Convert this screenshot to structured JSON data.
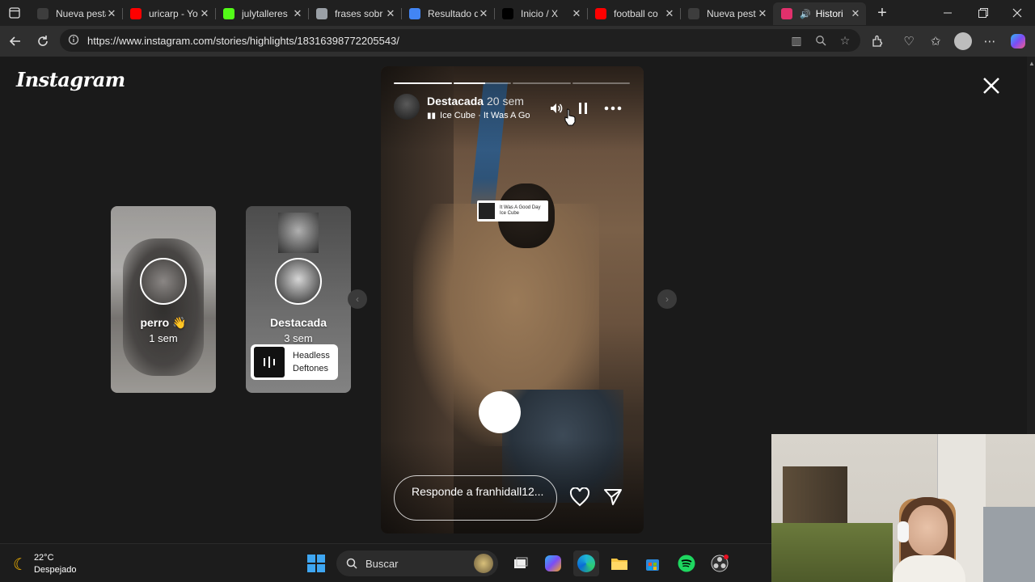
{
  "browser": {
    "tabs": [
      {
        "title": "Nueva pesta",
        "favicon_color": "#3d3d3d",
        "icon": "page-icon"
      },
      {
        "title": "uricarp - Yo",
        "favicon_color": "#ff0000",
        "icon": "youtube-icon"
      },
      {
        "title": "julytalleres",
        "favicon_color": "#53fc18",
        "icon": "kick-icon"
      },
      {
        "title": "frases sobr",
        "favicon_color": "#9aa0a6",
        "icon": "globe-icon"
      },
      {
        "title": "Resultado d",
        "favicon_color": "#4285f4",
        "icon": "google-icon"
      },
      {
        "title": "Inicio / X",
        "favicon_color": "#000000",
        "icon": "x-logo-icon"
      },
      {
        "title": "football co",
        "favicon_color": "#ff0000",
        "icon": "youtube-icon"
      },
      {
        "title": "Nueva pest",
        "favicon_color": "#3d3d3d",
        "icon": "page-icon"
      },
      {
        "title": "Histori",
        "favicon_color": "#e1306c",
        "icon": "instagram-icon",
        "active": true
      }
    ],
    "url": "https://www.instagram.com/stories/highlights/18316398772205543/"
  },
  "instagram": {
    "logo_text": "Instagram",
    "previews": [
      {
        "name": "perro 👋",
        "time": "1 sem"
      },
      {
        "name": "Destacada",
        "time": "3 sem",
        "song_title": "Headless",
        "song_artist": "Deftones"
      }
    ],
    "story": {
      "username": "Destacada",
      "time": "20 sem",
      "song": "Ice Cube · It Was A Go",
      "progress": [
        1.0,
        0.55,
        0.0,
        0.0
      ],
      "sticker_song_title": "It Was A Good Day",
      "sticker_song_artist": "Ice Cube",
      "reaction_emoji": "😴",
      "reply_placeholder": "Responde a franhidall12..."
    }
  },
  "taskbar": {
    "temperature": "22°C",
    "weather": "Despejado",
    "search_label": "Buscar"
  }
}
